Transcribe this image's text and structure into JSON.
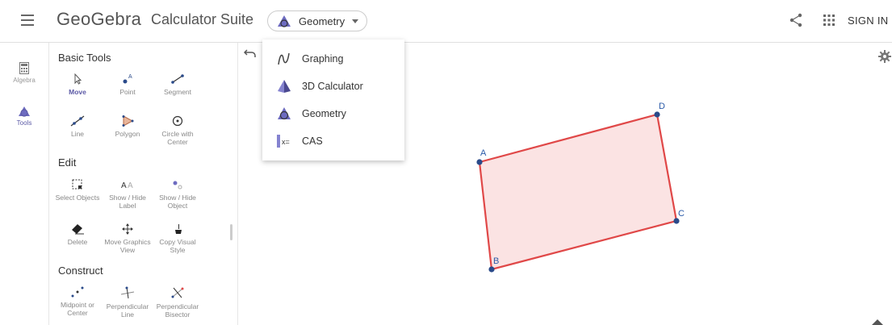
{
  "header": {
    "logo": "GeoGebra",
    "suite_title": "Calculator Suite",
    "app_selector": "Geometry",
    "sign_in": "SIGN IN"
  },
  "rail": {
    "items": [
      {
        "label": "Algebra",
        "icon": "calculator-icon"
      },
      {
        "label": "Tools",
        "icon": "tools-icon"
      }
    ]
  },
  "tools_panel": {
    "sections": [
      {
        "title": "Basic Tools",
        "tools": [
          {
            "label": "Move",
            "active": true
          },
          {
            "label": "Point"
          },
          {
            "label": "Segment"
          },
          {
            "label": "Line"
          },
          {
            "label": "Polygon"
          },
          {
            "label": "Circle with Center"
          }
        ]
      },
      {
        "title": "Edit",
        "tools": [
          {
            "label": "Select Objects"
          },
          {
            "label": "Show / Hide Label"
          },
          {
            "label": "Show / Hide Object"
          },
          {
            "label": "Delete"
          },
          {
            "label": "Move Graphics View"
          },
          {
            "label": "Copy Visual Style"
          }
        ]
      },
      {
        "title": "Construct",
        "tools": [
          {
            "label": "Midpoint or Center"
          },
          {
            "label": "Perpendicular Line"
          },
          {
            "label": "Perpendicular Bisector"
          }
        ]
      }
    ]
  },
  "dropdown": {
    "items": [
      {
        "label": "Graphing",
        "icon": "graphing-icon"
      },
      {
        "label": "3D Calculator",
        "icon": "3d-calculator-icon"
      },
      {
        "label": "Geometry",
        "icon": "geometry-icon"
      },
      {
        "label": "CAS",
        "icon": "cas-icon"
      }
    ]
  },
  "canvas": {
    "points": [
      "A",
      "B",
      "C",
      "D"
    ]
  },
  "colors": {
    "accent": "#5c5aa6",
    "polygon_stroke": "#e04848",
    "polygon_fill": "#f9d9d9",
    "point": "#2a4a8a"
  }
}
